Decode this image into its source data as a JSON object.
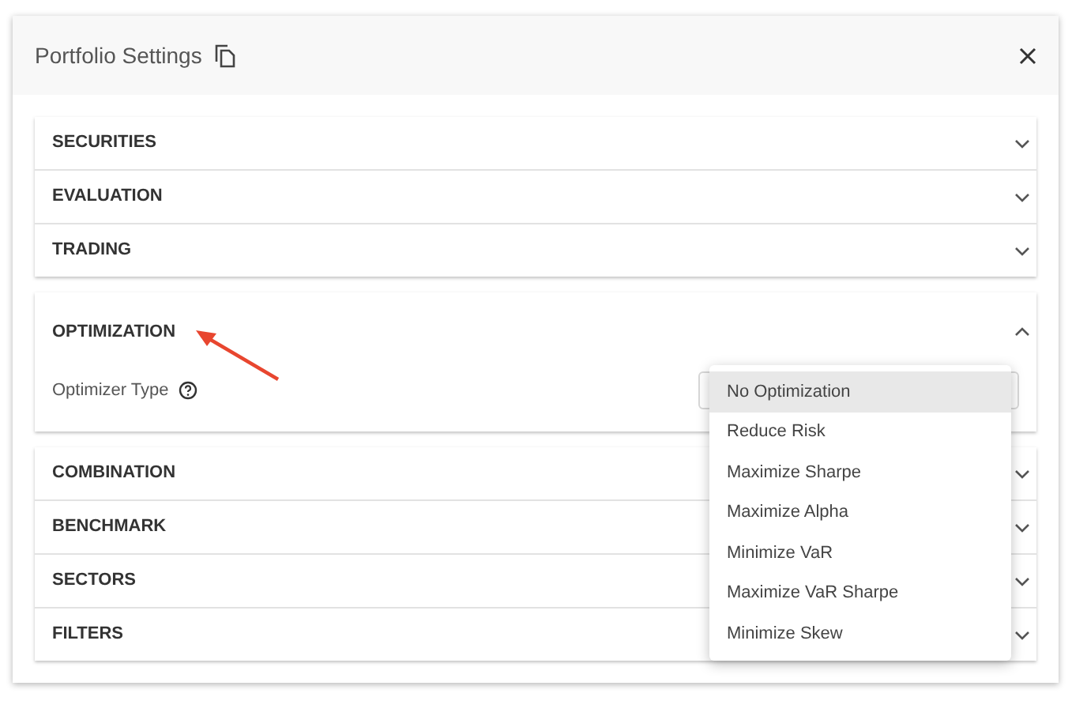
{
  "dialog": {
    "title": "Portfolio Settings"
  },
  "groups": [
    [
      {
        "label": "SECURITIES",
        "expanded": false
      },
      {
        "label": "EVALUATION",
        "expanded": false
      },
      {
        "label": "TRADING",
        "expanded": false
      }
    ],
    [
      {
        "label": "OPTIMIZATION",
        "expanded": true,
        "field": {
          "label": "Optimizer Type",
          "options": [
            {
              "label": "No Optimization",
              "selected": true
            },
            {
              "label": "Reduce Risk",
              "selected": false
            },
            {
              "label": "Maximize Sharpe",
              "selected": false
            },
            {
              "label": "Maximize Alpha",
              "selected": false
            },
            {
              "label": "Minimize VaR",
              "selected": false
            },
            {
              "label": "Maximize VaR Sharpe",
              "selected": false
            },
            {
              "label": "Minimize Skew",
              "selected": false
            }
          ]
        }
      }
    ],
    [
      {
        "label": "COMBINATION",
        "expanded": false
      },
      {
        "label": "BENCHMARK",
        "expanded": false
      },
      {
        "label": "SECTORS",
        "expanded": false
      },
      {
        "label": "FILTERS",
        "expanded": false
      }
    ]
  ]
}
